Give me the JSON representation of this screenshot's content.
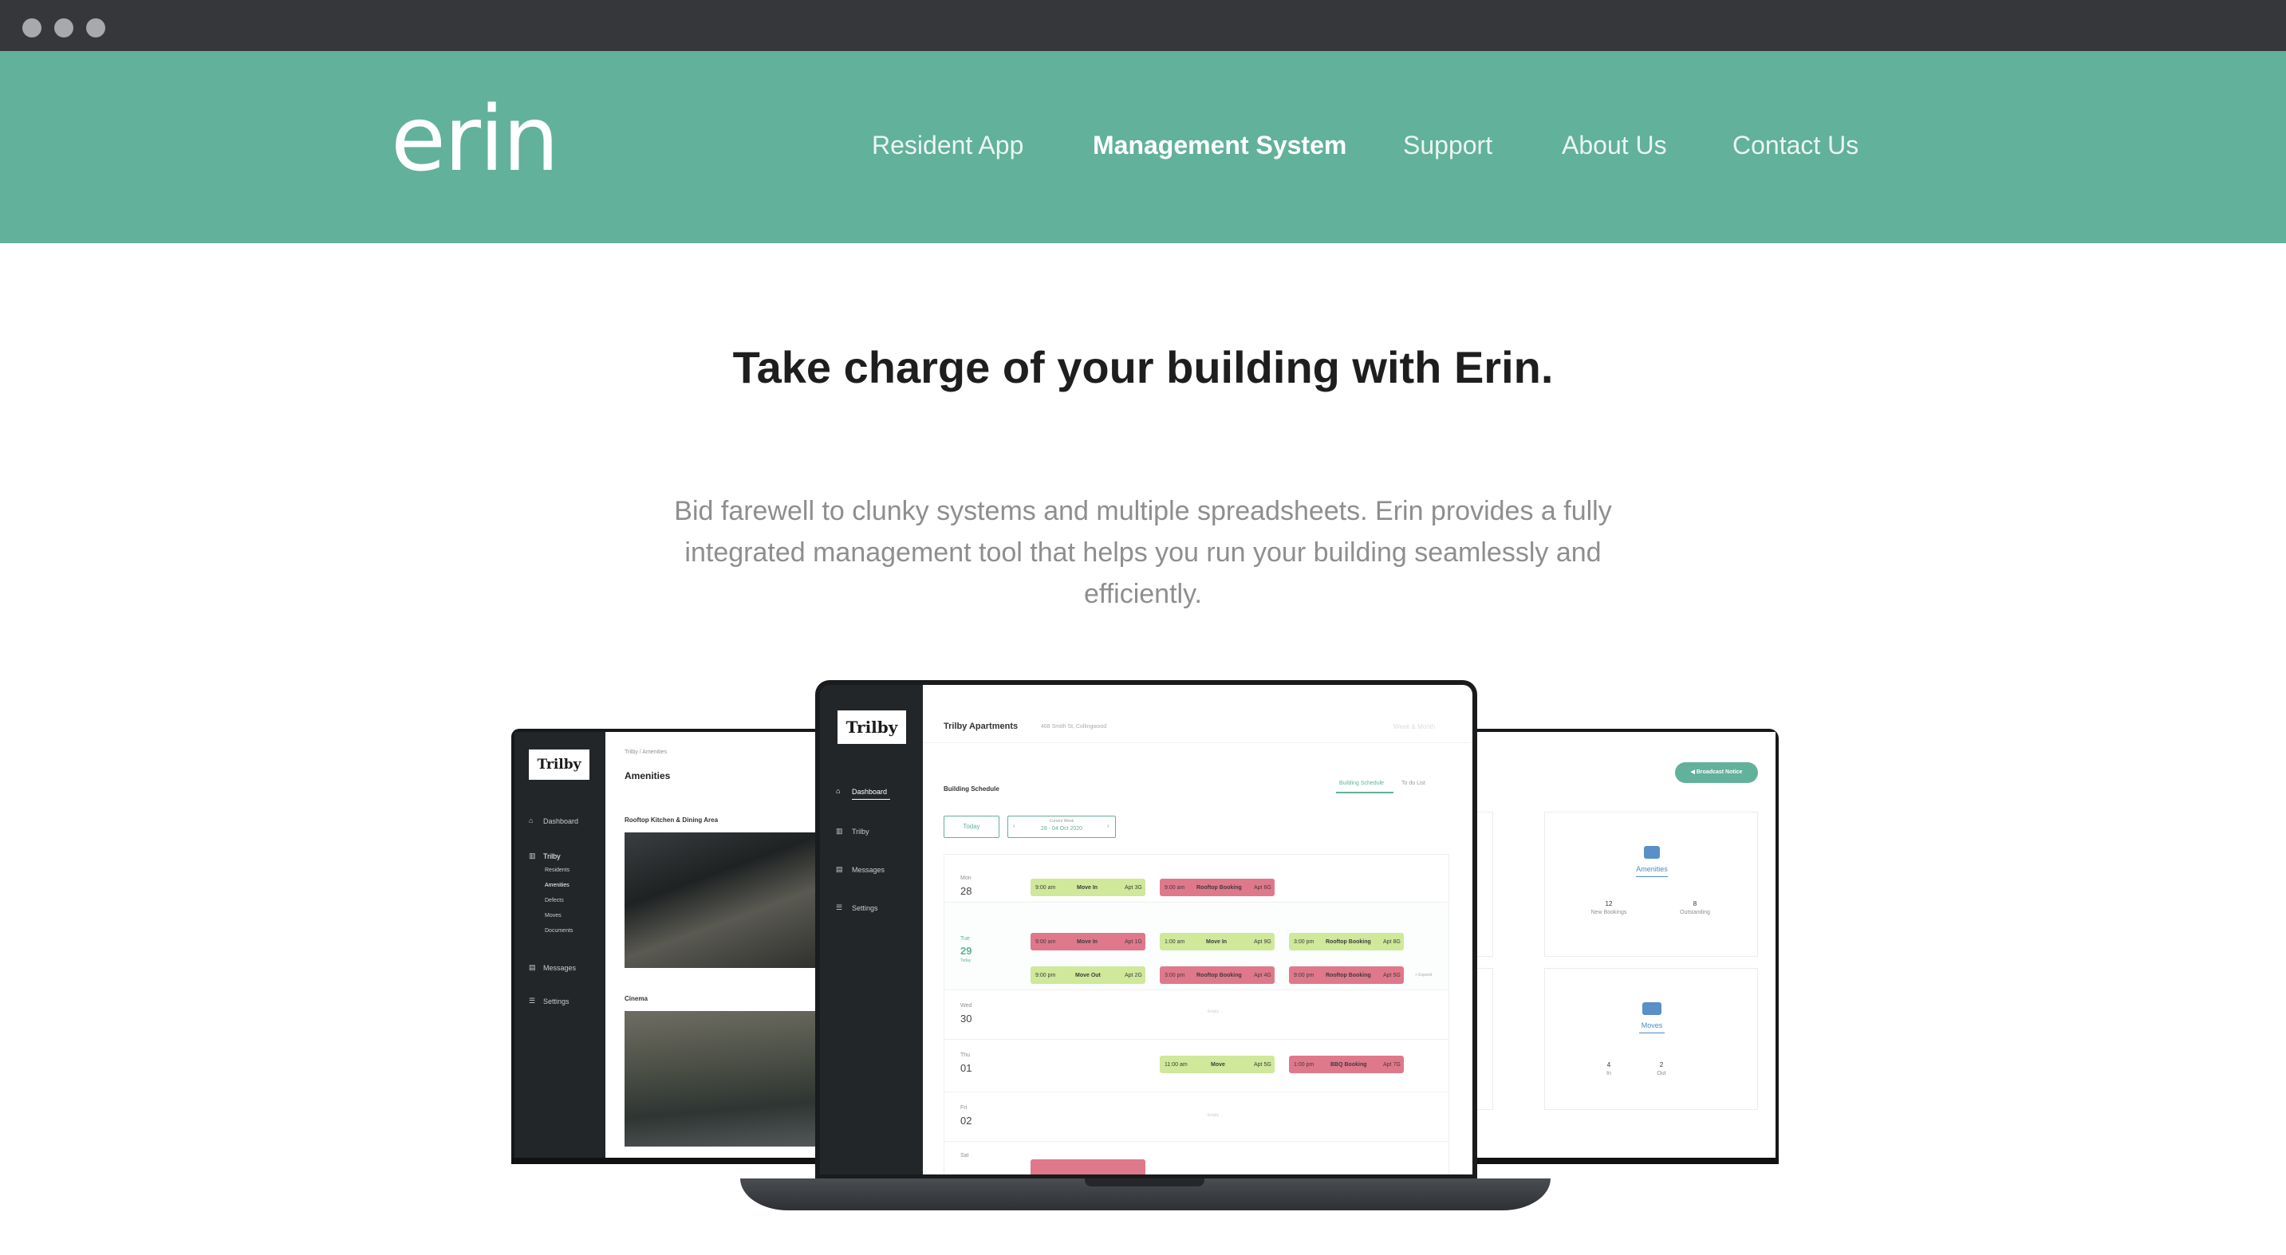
{
  "logo": "erin",
  "nav": {
    "items": [
      "Resident App",
      "Management System",
      "Support",
      "About Us",
      "Contact Us"
    ],
    "active": "Management System"
  },
  "hero": {
    "title": "Take charge of your building with Erin.",
    "description": "Bid farewell to clunky systems and multiple spreadsheets. Erin provides a fully integrated management tool that helps you run your building seamlessly and efficiently."
  },
  "colors": {
    "brand": "#62b19a",
    "chrome": "#36373a",
    "sidebar": "#232629"
  },
  "left_screen": {
    "brand": "Trilby",
    "breadcrumb": "Trilby  /  Amenities",
    "title": "Amenities",
    "sidebar": [
      "Dashboard",
      "Trilby",
      "Messages",
      "Settings"
    ],
    "submenu": [
      "Residents",
      "Amenities",
      "Defects",
      "Moves",
      "Documents"
    ],
    "sections": [
      "Rooftop Kitchen & Dining Area",
      "Cinema"
    ]
  },
  "center_screen": {
    "brand": "Trilby",
    "building": "Trilby Apartments",
    "address": "468 Smith St, Collingwood",
    "user": "Week & Month",
    "sidebar": [
      "Dashboard",
      "Trilby",
      "Messages",
      "Settings"
    ],
    "section": "Building Schedule",
    "tabs": [
      "Building Schedule",
      "To do List"
    ],
    "today": "Today",
    "week_label": "Current Week",
    "week_range": "28 - 04 Oct 2020",
    "days": [
      {
        "dow": "Mon",
        "num": "28"
      },
      {
        "dow": "Tue",
        "num": "29",
        "note": "Today"
      },
      {
        "dow": "Wed",
        "num": "30",
        "empty": "Empty"
      },
      {
        "dow": "Thu",
        "num": "01"
      },
      {
        "dow": "Fri",
        "num": "02",
        "empty": "Empty"
      },
      {
        "dow": "Sat",
        "num": ""
      }
    ],
    "expand": "+ Expand"
  },
  "right_screen": {
    "broadcast": "Broadcast Notice",
    "cards": [
      {
        "title": "Amenities",
        "stats": [
          {
            "v": "12",
            "l": "New Bookings"
          },
          {
            "v": "8",
            "l": "Outstanding"
          }
        ]
      },
      {
        "title": "Moves",
        "stats": [
          {
            "v": "4",
            "l": "In"
          },
          {
            "v": "2",
            "l": "Out"
          }
        ]
      }
    ]
  }
}
